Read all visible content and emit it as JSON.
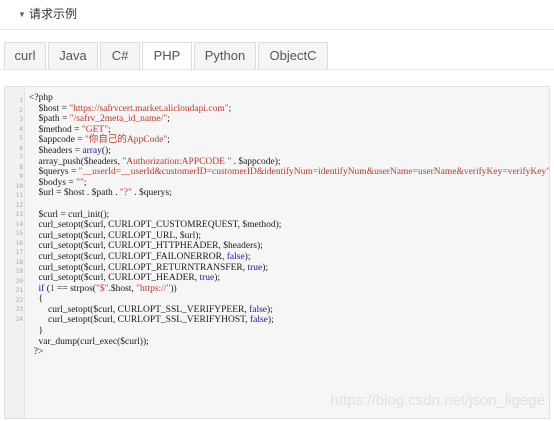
{
  "section": {
    "caret_icon": "caret-down-icon",
    "title": "请求示例"
  },
  "tabs": [
    {
      "label": "curl",
      "active": false
    },
    {
      "label": "Java",
      "active": false
    },
    {
      "label": "C#",
      "active": false
    },
    {
      "label": "PHP",
      "active": true
    },
    {
      "label": "Python",
      "active": false
    },
    {
      "label": "ObjectC",
      "active": false
    }
  ],
  "code": {
    "line_numbers": [
      "1",
      "2",
      "3",
      "4",
      "5",
      "6",
      "7",
      "8",
      "9",
      "10",
      "11",
      "12",
      "13",
      "14",
      "15",
      "16",
      "17",
      "18",
      "19",
      "20",
      "21",
      "22",
      "23",
      "24"
    ],
    "lines": [
      [
        {
          "t": "<?php"
        }
      ],
      [
        {
          "t": "    $host = "
        },
        {
          "t": "\"https://safrvcert.market.alicloudapi.com\"",
          "c": "s"
        },
        {
          "t": ";"
        }
      ],
      [
        {
          "t": "    $path = "
        },
        {
          "t": "\"/safrv_2meta_id_name/\"",
          "c": "s"
        },
        {
          "t": ";"
        }
      ],
      [
        {
          "t": "    $method = "
        },
        {
          "t": "\"GET\"",
          "c": "s"
        },
        {
          "t": ";"
        }
      ],
      [
        {
          "t": "    $appcode = "
        },
        {
          "t": "\"你自己的AppCode\"",
          "c": "s"
        },
        {
          "t": ";"
        }
      ],
      [
        {
          "t": "    $headers = "
        },
        {
          "t": "array",
          "c": "k"
        },
        {
          "t": "();"
        }
      ],
      [
        {
          "t": "    array_push($headers, "
        },
        {
          "t": "\"Authorization:APPCODE \"",
          "c": "s"
        },
        {
          "t": " . $appcode);"
        }
      ],
      [
        {
          "t": "    $querys = "
        },
        {
          "t": "\"__userId=__userId&customerID=customerID&identifyNum=identifyNum&userName=userName&verifyKey=verifyKey\"",
          "c": "s"
        },
        {
          "t": ";"
        }
      ],
      [
        {
          "t": "    $bodys = "
        },
        {
          "t": "\"\"",
          "c": "s"
        },
        {
          "t": ";"
        }
      ],
      [
        {
          "t": "    $url = $host . $path . "
        },
        {
          "t": "\"?\"",
          "c": "s"
        },
        {
          "t": " . $querys;"
        }
      ],
      [
        {
          "t": ""
        }
      ],
      [
        {
          "t": "    $curl = curl_init();"
        }
      ],
      [
        {
          "t": "    curl_setopt($curl, CURLOPT_CUSTOMREQUEST, $method);"
        }
      ],
      [
        {
          "t": "    curl_setopt($curl, CURLOPT_URL, $url);"
        }
      ],
      [
        {
          "t": "    curl_setopt($curl, CURLOPT_HTTPHEADER, $headers);"
        }
      ],
      [
        {
          "t": "    curl_setopt($curl, CURLOPT_FAILONERROR, "
        },
        {
          "t": "false",
          "c": "k"
        },
        {
          "t": ");"
        }
      ],
      [
        {
          "t": "    curl_setopt($curl, CURLOPT_RETURNTRANSFER, "
        },
        {
          "t": "true",
          "c": "k"
        },
        {
          "t": ");"
        }
      ],
      [
        {
          "t": "    curl_setopt($curl, CURLOPT_HEADER, "
        },
        {
          "t": "true",
          "c": "k"
        },
        {
          "t": ");"
        }
      ],
      [
        {
          "t": "    "
        },
        {
          "t": "if",
          "c": "k"
        },
        {
          "t": " ("
        },
        {
          "t": "1",
          "c": "n"
        },
        {
          "t": " == strpos("
        },
        {
          "t": "\"$\"",
          "c": "s"
        },
        {
          "t": ".$host, "
        },
        {
          "t": "\"https://\"",
          "c": "s"
        },
        {
          "t": "))"
        }
      ],
      [
        {
          "t": "    {"
        }
      ],
      [
        {
          "t": "        curl_setopt($curl, CURLOPT_SSL_VERIFYPEER, "
        },
        {
          "t": "false",
          "c": "k"
        },
        {
          "t": ");"
        }
      ],
      [
        {
          "t": "        curl_setopt($curl, CURLOPT_SSL_VERIFYHOST, "
        },
        {
          "t": "false",
          "c": "k"
        },
        {
          "t": ");"
        }
      ],
      [
        {
          "t": "    }"
        }
      ],
      [
        {
          "t": "    var_dump(curl_exec($curl));"
        }
      ],
      [
        {
          "t": "  ?>"
        }
      ]
    ]
  },
  "watermark": "https://blog.csdn.net/json_ligege"
}
